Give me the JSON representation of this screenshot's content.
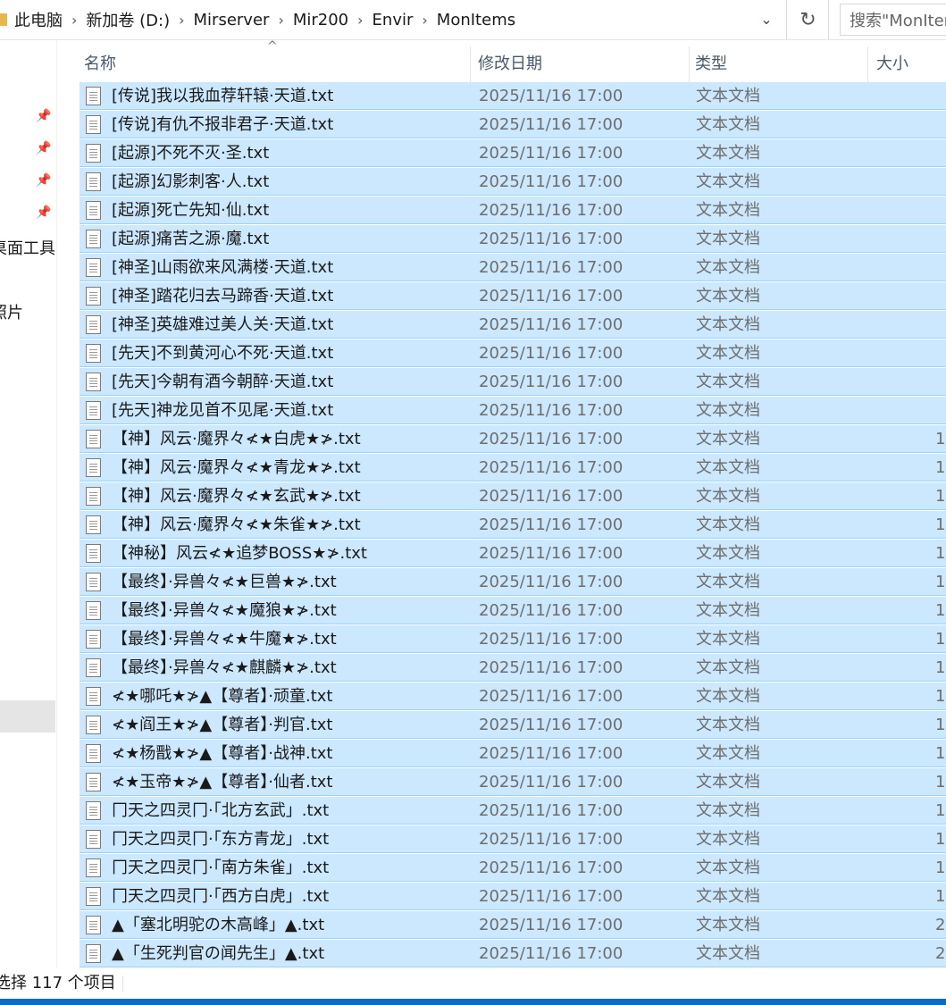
{
  "breadcrumb": [
    "此电脑",
    "新加卷 (D:)",
    "Mirserver",
    "Mir200",
    "Envir",
    "MonItems"
  ],
  "search": {
    "placeholder": "搜索\"MonItems\""
  },
  "nav": {
    "labels": [
      "桌面工具",
      "照片"
    ]
  },
  "columns": {
    "name": "名称",
    "date": "修改日期",
    "type": "类型",
    "size": "大小"
  },
  "files": [
    {
      "name": "[传说]我以我血荐轩辕·天道.txt",
      "date": "2025/11/16 17:00",
      "type": "文本文档",
      "size": ""
    },
    {
      "name": "[传说]有仇不报非君子·天道.txt",
      "date": "2025/11/16 17:00",
      "type": "文本文档",
      "size": ""
    },
    {
      "name": "[起源]不死不灭·圣.txt",
      "date": "2025/11/16 17:00",
      "type": "文本文档",
      "size": ""
    },
    {
      "name": "[起源]幻影刺客·人.txt",
      "date": "2025/11/16 17:00",
      "type": "文本文档",
      "size": ""
    },
    {
      "name": "[起源]死亡先知·仙.txt",
      "date": "2025/11/16 17:00",
      "type": "文本文档",
      "size": ""
    },
    {
      "name": "[起源]痛苦之源·魔.txt",
      "date": "2025/11/16 17:00",
      "type": "文本文档",
      "size": ""
    },
    {
      "name": "[神圣]山雨欲来风满楼·天道.txt",
      "date": "2025/11/16 17:00",
      "type": "文本文档",
      "size": ""
    },
    {
      "name": "[神圣]踏花归去马蹄香·天道.txt",
      "date": "2025/11/16 17:00",
      "type": "文本文档",
      "size": ""
    },
    {
      "name": "[神圣]英雄难过美人关·天道.txt",
      "date": "2025/11/16 17:00",
      "type": "文本文档",
      "size": ""
    },
    {
      "name": "[先天]不到黄河心不死·天道.txt",
      "date": "2025/11/16 17:00",
      "type": "文本文档",
      "size": ""
    },
    {
      "name": "[先天]今朝有酒今朝醉·天道.txt",
      "date": "2025/11/16 17:00",
      "type": "文本文档",
      "size": ""
    },
    {
      "name": "[先天]神龙见首不见尾·天道.txt",
      "date": "2025/11/16 17:00",
      "type": "文本文档",
      "size": ""
    },
    {
      "name": "【神】风云·魔界々≮★白虎★≯.txt",
      "date": "2025/11/16 17:00",
      "type": "文本文档",
      "size": "1"
    },
    {
      "name": "【神】风云·魔界々≮★青龙★≯.txt",
      "date": "2025/11/16 17:00",
      "type": "文本文档",
      "size": "1"
    },
    {
      "name": "【神】风云·魔界々≮★玄武★≯.txt",
      "date": "2025/11/16 17:00",
      "type": "文本文档",
      "size": "1"
    },
    {
      "name": "【神】风云·魔界々≮★朱雀★≯.txt",
      "date": "2025/11/16 17:00",
      "type": "文本文档",
      "size": "1"
    },
    {
      "name": "【神秘】风云≮★追梦BOSS★≯.txt",
      "date": "2025/11/16 17:00",
      "type": "文本文档",
      "size": "1"
    },
    {
      "name": "【最终】·异兽々≮★巨兽★≯.txt",
      "date": "2025/11/16 17:00",
      "type": "文本文档",
      "size": "1"
    },
    {
      "name": "【最终】·异兽々≮★魔狼★≯.txt",
      "date": "2025/11/16 17:00",
      "type": "文本文档",
      "size": "1"
    },
    {
      "name": "【最终】·异兽々≮★牛魔★≯.txt",
      "date": "2025/11/16 17:00",
      "type": "文本文档",
      "size": "1"
    },
    {
      "name": "【最终】·异兽々≮★麒麟★≯.txt",
      "date": "2025/11/16 17:00",
      "type": "文本文档",
      "size": "1"
    },
    {
      "name": "≮★哪吒★≯▲【尊者】·顽童.txt",
      "date": "2025/11/16 17:00",
      "type": "文本文档",
      "size": "1"
    },
    {
      "name": "≮★阎王★≯▲【尊者】·判官.txt",
      "date": "2025/11/16 17:00",
      "type": "文本文档",
      "size": "1"
    },
    {
      "name": "≮★杨戬★≯▲【尊者】·战神.txt",
      "date": "2025/11/16 17:00",
      "type": "文本文档",
      "size": "1"
    },
    {
      "name": "≮★玉帝★≯▲【尊者】·仙者.txt",
      "date": "2025/11/16 17:00",
      "type": "文本文档",
      "size": "1"
    },
    {
      "name": "冂天之四灵冂·「北方玄武」.txt",
      "date": "2025/11/16 17:00",
      "type": "文本文档",
      "size": "1"
    },
    {
      "name": "冂天之四灵冂·「东方青龙」.txt",
      "date": "2025/11/16 17:00",
      "type": "文本文档",
      "size": "1"
    },
    {
      "name": "冂天之四灵冂·「南方朱雀」.txt",
      "date": "2025/11/16 17:00",
      "type": "文本文档",
      "size": "1"
    },
    {
      "name": "冂天之四灵冂·「西方白虎」.txt",
      "date": "2025/11/16 17:00",
      "type": "文本文档",
      "size": "1"
    },
    {
      "name": "▲「塞北明驼の木高峰」▲.txt",
      "date": "2025/11/16 17:00",
      "type": "文本文档",
      "size": "2"
    },
    {
      "name": "▲「生死判官の闻先生」▲.txt",
      "date": "2025/11/16 17:00",
      "type": "文本文档",
      "size": "2"
    }
  ],
  "status": {
    "text": "选择 117 个项目"
  }
}
